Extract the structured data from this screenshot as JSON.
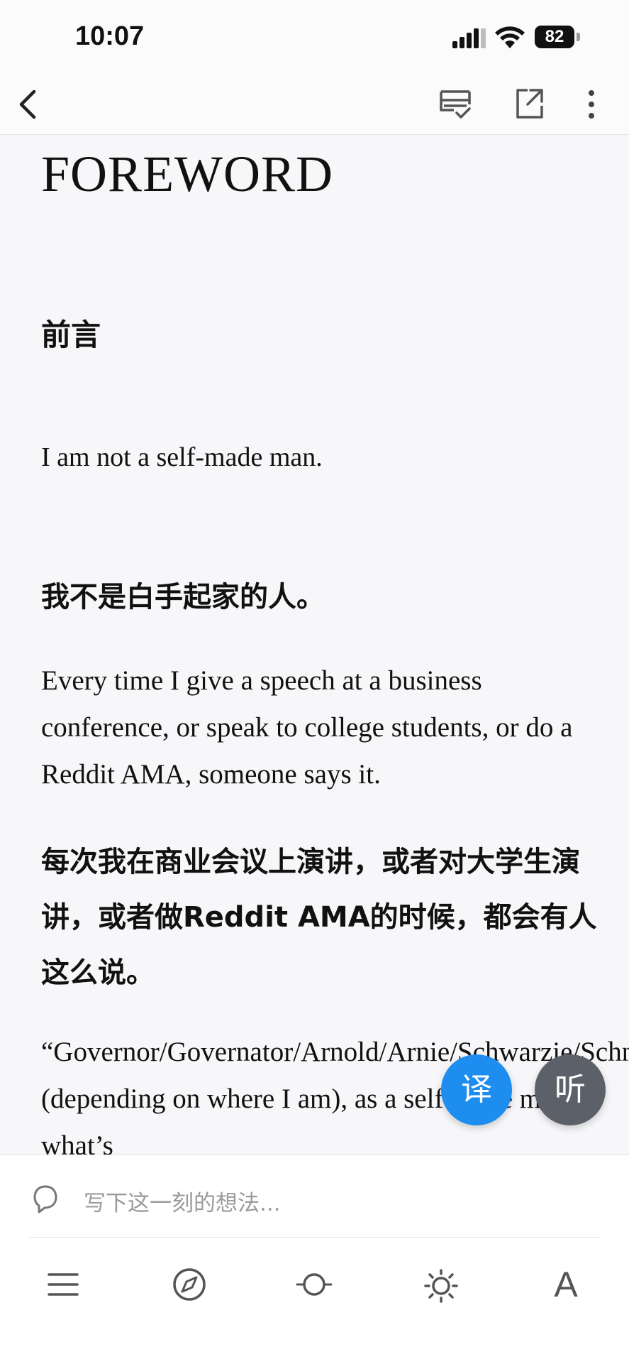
{
  "status_bar": {
    "time": "10:07",
    "battery": "82",
    "icons": [
      "signal-icon",
      "wifi-icon",
      "battery-icon"
    ]
  },
  "nav": {
    "icons": [
      "back-icon",
      "note-check-icon",
      "share-external-icon",
      "more-vertical-icon"
    ]
  },
  "content": {
    "title": "FOREWORD",
    "cn_heading": "前言",
    "en_paragraph_1": "I am not a self-made man.",
    "cn_paragraph_1": "我不是白手起家的人。",
    "en_paragraph_2": "Every time I give a speech at a business conference, or speak to college students, or do a Reddit AMA, someone says it.",
    "cn_paragraph_2": "每次我在商业会议上演讲，或者对大学生演讲，或者做Reddit AMA的时候，都会有人这么说。",
    "en_paragraph_3": "“Governor/Governator/Arnold/Arnie/Schwarzie/Schnitzel (depending on where I am), as a self-made man, what’s"
  },
  "floating_buttons": {
    "translate_label": "译",
    "listen_label": "听"
  },
  "bottom": {
    "thought_placeholder": "写下这一刻的想法...",
    "font_button_label": "A",
    "toolbar_icons": [
      "menu-icon",
      "compass-icon",
      "progress-icon",
      "brightness-icon",
      "font-icon"
    ]
  },
  "colors": {
    "accent_blue": "#1e8df0",
    "listen_gray": "#5c6069",
    "page_background": "#f7f7f9"
  }
}
